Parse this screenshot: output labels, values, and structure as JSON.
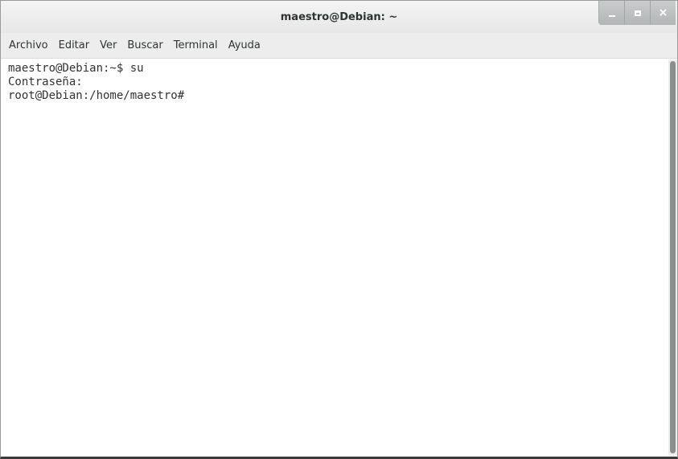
{
  "window": {
    "title": "maestro@Debian: ~",
    "buttons": [
      {
        "name": "minimize",
        "icon": "minimize-icon"
      },
      {
        "name": "maximize",
        "icon": "maximize-icon"
      },
      {
        "name": "close",
        "icon": "close-icon",
        "glyph": "×"
      }
    ]
  },
  "menu": {
    "items": [
      "Archivo",
      "Editar",
      "Ver",
      "Buscar",
      "Terminal",
      "Ayuda"
    ]
  },
  "terminal": {
    "lines": [
      "maestro@Debian:~$ su",
      "Contraseña:",
      "root@Debian:/home/maestro#"
    ]
  }
}
